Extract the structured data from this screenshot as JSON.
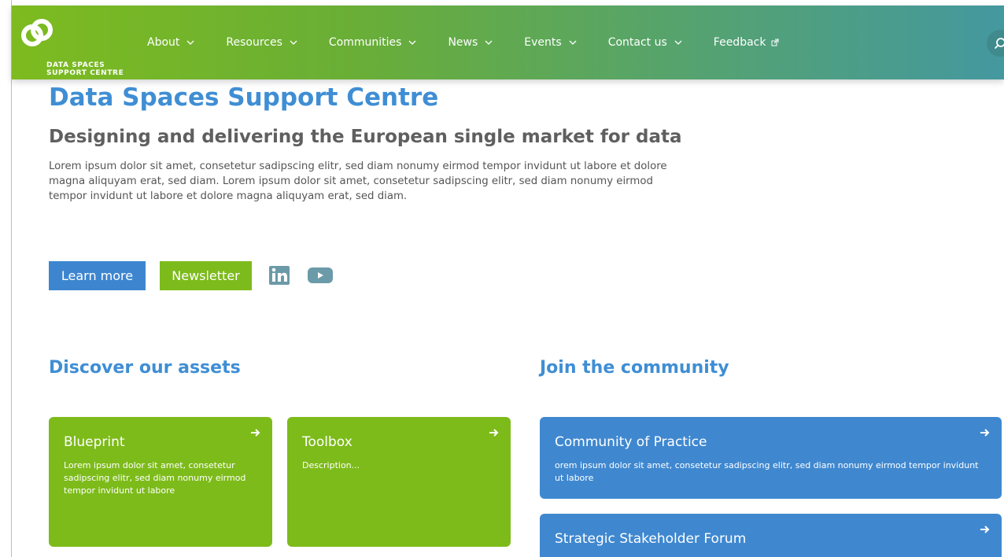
{
  "brand": {
    "logo_text": "DATA SPACES\nSUPPORT CENTRE",
    "colors": {
      "green": "#7dbb1c",
      "blue": "#3d86cf",
      "header_end": "#44989f"
    }
  },
  "nav": {
    "items": [
      {
        "label": "About",
        "icon": "chevron-down-icon"
      },
      {
        "label": "Resources",
        "icon": "chevron-down-icon"
      },
      {
        "label": "Communities",
        "icon": "chevron-down-icon"
      },
      {
        "label": "News",
        "icon": "chevron-down-icon"
      },
      {
        "label": "Events",
        "icon": "chevron-down-icon"
      },
      {
        "label": "Contact us",
        "icon": "chevron-down-icon"
      },
      {
        "label": "Feedback",
        "icon": "external-link-icon"
      }
    ],
    "search_icon": "search-icon"
  },
  "hero": {
    "title": "Data Spaces Support Centre",
    "subtitle": "Designing and delivering the European single market for data",
    "body": "Lorem ipsum dolor sit amet, consetetur sadipscing elitr, sed diam nonumy eirmod tempor invidunt ut labore et dolore magna aliquyam erat, sed diam. Lorem ipsum dolor sit amet, consetetur sadipscing elitr, sed diam nonumy eirmod tempor invidunt ut labore et dolore magna aliquyam erat, sed diam.",
    "learn_more_label": "Learn more",
    "newsletter_label": "Newsletter",
    "social": [
      "linkedin-icon",
      "youtube-icon"
    ]
  },
  "assets": {
    "heading": "Discover our assets",
    "cards": [
      {
        "title": "Blueprint",
        "description": "Lorem ipsum dolor sit amet, consetetur sadipscing elitr, sed diam nonumy eirmod tempor invidunt ut labore"
      },
      {
        "title": "Toolbox",
        "description": "Description..."
      }
    ]
  },
  "community": {
    "heading": "Join the community",
    "cards": [
      {
        "title": "Community of Practice",
        "description": "orem ipsum dolor sit amet, consetetur sadipscing elitr, sed diam nonumy eirmod tempor invidunt ut labore"
      },
      {
        "title": "Strategic Stakeholder Forum",
        "description": ""
      }
    ]
  }
}
